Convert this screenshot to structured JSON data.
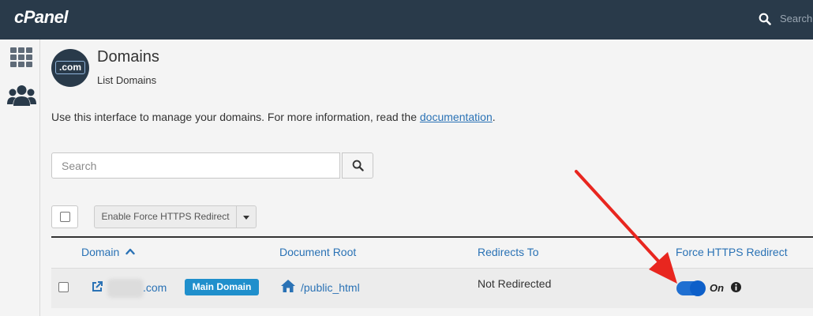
{
  "header": {
    "logo_text": "cPanel",
    "search_placeholder": "Search"
  },
  "sidebar": {
    "items": [
      {
        "icon": "grid-icon"
      },
      {
        "icon": "users-icon"
      }
    ]
  },
  "page": {
    "icon_text": ".com",
    "title": "Domains",
    "subtitle": "List Domains",
    "intro_text": "Use this interface to manage your domains. For more information, read the ",
    "intro_link": "documentation",
    "intro_end": "."
  },
  "search": {
    "placeholder": "Search"
  },
  "toolbar": {
    "action_label": "Enable Force HTTPS Redirect"
  },
  "table": {
    "headers": {
      "domain": "Domain",
      "document_root": "Document Root",
      "redirects_to": "Redirects To",
      "force_https": "Force HTTPS Redirect"
    },
    "rows": [
      {
        "domain": ".com",
        "badge": "Main Domain",
        "document_root": "/public_html",
        "redirects_to": "Not Redirected",
        "force_https_state": "On"
      }
    ]
  },
  "colors": {
    "topbar": "#293a4a",
    "link": "#2a72b5",
    "badge": "#1f8fcc",
    "toggle": "#1f6fd1",
    "annotation_arrow": "#e8261f"
  }
}
